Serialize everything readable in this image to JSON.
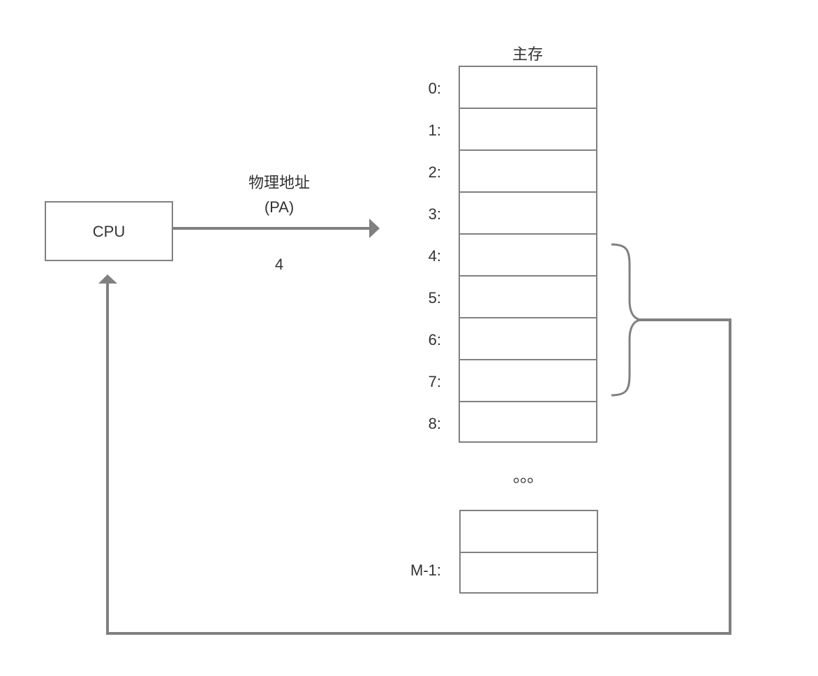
{
  "cpu": {
    "label": "CPU"
  },
  "arrow_label": {
    "line1": "物理地址",
    "line2": "(PA)",
    "value": "4"
  },
  "memory": {
    "title": "主存",
    "rows": [
      {
        "addr": "0:"
      },
      {
        "addr": "1:"
      },
      {
        "addr": "2:"
      },
      {
        "addr": "3:"
      },
      {
        "addr": "4:"
      },
      {
        "addr": "5:"
      },
      {
        "addr": "6:"
      },
      {
        "addr": "7:"
      },
      {
        "addr": "8:"
      }
    ],
    "ellipsis": "。。。",
    "last_row": {
      "addr": "M-1:"
    }
  },
  "colors": {
    "line": "#808080",
    "text": "#333333"
  }
}
